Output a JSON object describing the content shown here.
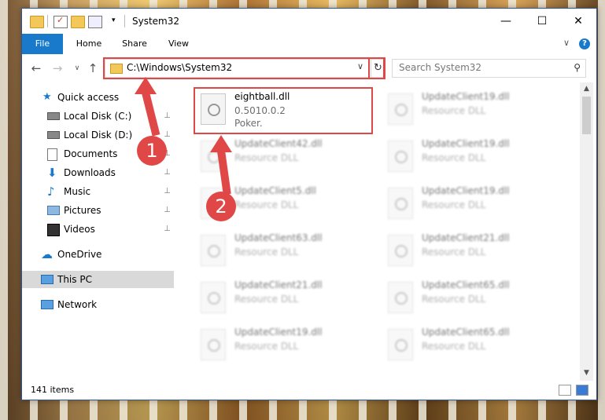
{
  "window": {
    "title": "System32"
  },
  "window_controls": {
    "minimize": "—",
    "maximize": "☐",
    "close": "✕"
  },
  "ribbon": {
    "tabs": [
      "File",
      "Home",
      "Share",
      "View"
    ],
    "help": "?",
    "collapse": "∨"
  },
  "nav": {
    "back": "←",
    "forward": "→",
    "recent": "∨",
    "up": "↑"
  },
  "address": {
    "path": "C:\\Windows\\System32",
    "dropdown": "∨",
    "refresh": "↻"
  },
  "search": {
    "placeholder": "Search System32",
    "icon": "⚲"
  },
  "sidebar": {
    "items": [
      {
        "label": "Quick access",
        "icon": "star-icon",
        "pinned": false
      },
      {
        "label": "Local Disk (C:)",
        "icon": "drive-icon",
        "pinned": true
      },
      {
        "label": "Local Disk (D:)",
        "icon": "drive-icon",
        "pinned": true
      },
      {
        "label": "Documents",
        "icon": "documents-icon",
        "pinned": true
      },
      {
        "label": "Downloads",
        "icon": "download-icon",
        "pinned": true
      },
      {
        "label": "Music",
        "icon": "music-icon",
        "pinned": true
      },
      {
        "label": "Pictures",
        "icon": "pictures-icon",
        "pinned": true
      },
      {
        "label": "Videos",
        "icon": "videos-icon",
        "pinned": true
      },
      {
        "label": "OneDrive",
        "icon": "cloud-icon",
        "pinned": false
      },
      {
        "label": "This PC",
        "icon": "pc-icon",
        "pinned": false
      },
      {
        "label": "Network",
        "icon": "network-icon",
        "pinned": false
      }
    ],
    "pin_glyph": "📌"
  },
  "files": {
    "highlighted": {
      "name": "eightball.dll",
      "version": "0.5010.0.2",
      "description": "Poker."
    },
    "left_column": [
      {
        "name": "UpdateClient42.dll",
        "type": "Resource DLL"
      },
      {
        "name": "UpdateClient5.dll",
        "type": "Resource DLL"
      },
      {
        "name": "UpdateClient63.dll",
        "type": "Resource DLL"
      },
      {
        "name": "UpdateClient21.dll",
        "type": "Resource DLL"
      },
      {
        "name": "UpdateClient19.dll",
        "type": "Resource DLL"
      }
    ],
    "right_column": [
      {
        "name": "UpdateClient19.dll",
        "type": "Resource DLL"
      },
      {
        "name": "UpdateClient19.dll",
        "type": "Resource DLL"
      },
      {
        "name": "UpdateClient19.dll",
        "type": "Resource DLL"
      },
      {
        "name": "UpdateClient21.dll",
        "type": "Resource DLL"
      },
      {
        "name": "UpdateClient65.dll",
        "type": "Resource DLL"
      },
      {
        "name": "UpdateClient65.dll",
        "type": "Resource DLL"
      }
    ]
  },
  "status": {
    "item_count": "141 items"
  },
  "annotations": {
    "badge1": "1",
    "badge2": "2",
    "color": "#e04848"
  }
}
